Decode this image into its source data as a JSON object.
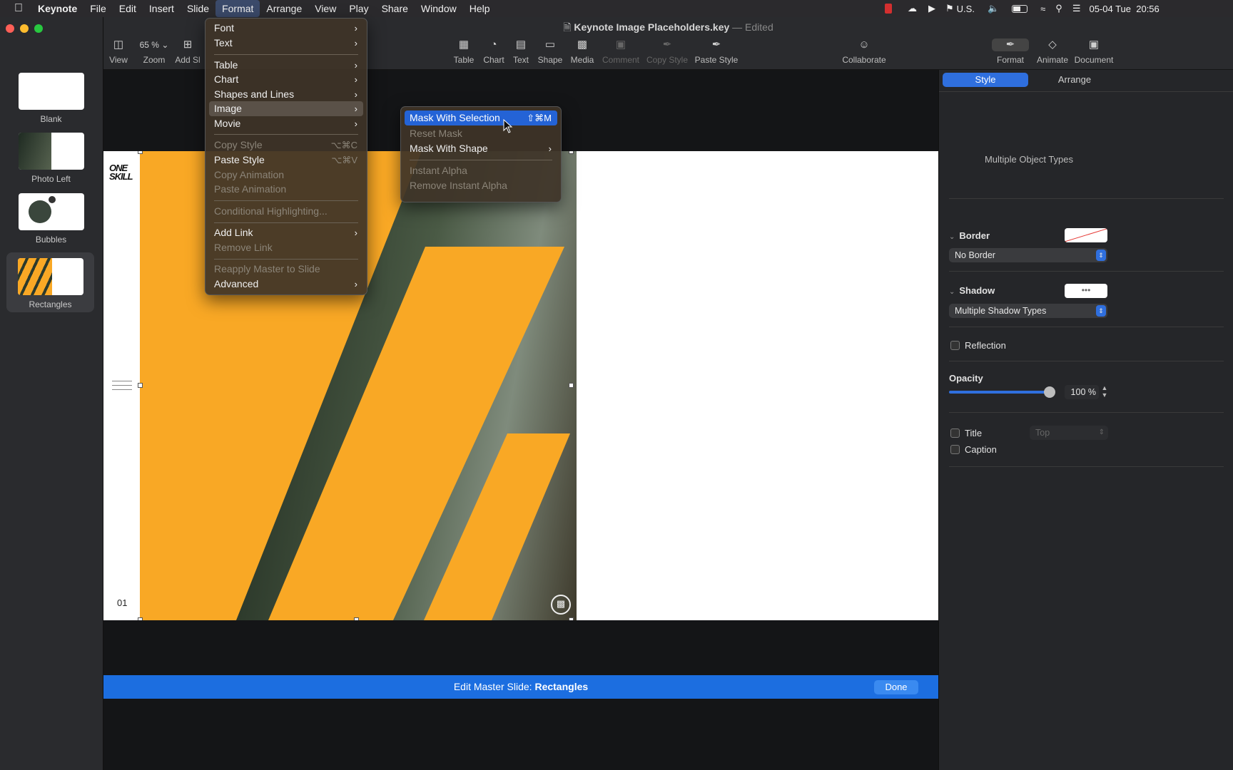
{
  "menubar": {
    "app": "Keynote",
    "items": [
      "File",
      "Edit",
      "Insert",
      "Slide",
      "Format",
      "Arrange",
      "View",
      "Play",
      "Share",
      "Window",
      "Help"
    ],
    "input_source": "U.S.",
    "datetime": "05-04 Tue  20:56"
  },
  "window": {
    "title": "Keynote Image Placeholders.key",
    "title_sep": "—",
    "status": "Edited"
  },
  "toolbar": {
    "view": "View",
    "zoom_value": "65 %",
    "zoom": "Zoom",
    "add_slide": "Add Sl",
    "table": "Table",
    "chart": "Chart",
    "text": "Text",
    "shape": "Shape",
    "media": "Media",
    "comment": "Comment",
    "copy_style": "Copy Style",
    "paste_style": "Paste Style",
    "collaborate": "Collaborate",
    "format": "Format",
    "animate": "Animate",
    "document": "Document"
  },
  "slides": [
    {
      "label": "Blank"
    },
    {
      "label": "Photo Left"
    },
    {
      "label": "Bubbles"
    },
    {
      "label": "Rectangles"
    }
  ],
  "slide": {
    "logo_line1": "ONE",
    "logo_line2": "SKILL",
    "page_number": "01"
  },
  "format_menu": {
    "items": [
      "Font",
      "Text",
      "Table",
      "Chart",
      "Shapes and Lines",
      "Image",
      "Movie",
      "Copy Style",
      "Paste Style",
      "Copy Animation",
      "Paste Animation",
      "Conditional Highlighting...",
      "Add Link",
      "Remove Link",
      "Reapply Master to Slide",
      "Advanced"
    ],
    "copy_style_shortcut": "⌥⌘C",
    "paste_style_shortcut": "⌥⌘V"
  },
  "image_submenu": {
    "items": [
      "Mask With Selection",
      "Reset Mask",
      "Mask With Shape",
      "Instant Alpha",
      "Remove Instant Alpha"
    ],
    "mask_shortcut": "⇧⌘M"
  },
  "inspector": {
    "tab_style": "Style",
    "tab_arrange": "Arrange",
    "object_types": "Multiple Object Types",
    "border_label": "Border",
    "border_value": "No Border",
    "shadow_label": "Shadow",
    "shadow_value": "Multiple Shadow Types",
    "reflection": "Reflection",
    "opacity_label": "Opacity",
    "opacity_value": "100 %",
    "opacity_fraction": 1.0,
    "title_label": "Title",
    "title_position": "Top",
    "caption_label": "Caption"
  },
  "editbar": {
    "prefix": "Edit Master Slide: ",
    "slide_name": "Rectangles",
    "done": "Done"
  },
  "colors": {
    "accent_orange": "#f9a825",
    "selection_blue": "#2463d6",
    "editbar_blue": "#1c6ee0"
  }
}
